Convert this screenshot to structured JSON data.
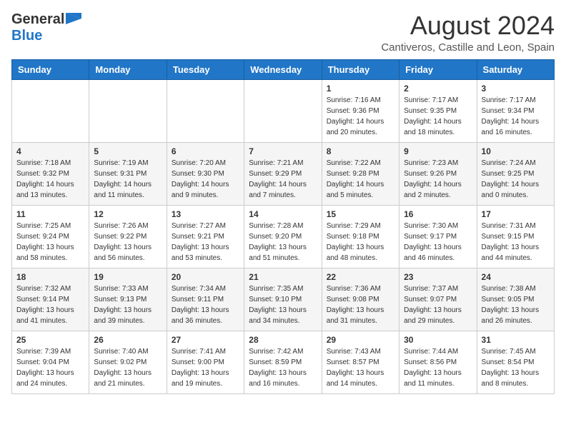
{
  "header": {
    "logo_general": "General",
    "logo_blue": "Blue",
    "month_year": "August 2024",
    "location": "Cantiveros, Castille and Leon, Spain"
  },
  "columns": [
    "Sunday",
    "Monday",
    "Tuesday",
    "Wednesday",
    "Thursday",
    "Friday",
    "Saturday"
  ],
  "weeks": [
    [
      {
        "day": "",
        "info": ""
      },
      {
        "day": "",
        "info": ""
      },
      {
        "day": "",
        "info": ""
      },
      {
        "day": "",
        "info": ""
      },
      {
        "day": "1",
        "info": "Sunrise: 7:16 AM\nSunset: 9:36 PM\nDaylight: 14 hours\nand 20 minutes."
      },
      {
        "day": "2",
        "info": "Sunrise: 7:17 AM\nSunset: 9:35 PM\nDaylight: 14 hours\nand 18 minutes."
      },
      {
        "day": "3",
        "info": "Sunrise: 7:17 AM\nSunset: 9:34 PM\nDaylight: 14 hours\nand 16 minutes."
      }
    ],
    [
      {
        "day": "4",
        "info": "Sunrise: 7:18 AM\nSunset: 9:32 PM\nDaylight: 14 hours\nand 13 minutes."
      },
      {
        "day": "5",
        "info": "Sunrise: 7:19 AM\nSunset: 9:31 PM\nDaylight: 14 hours\nand 11 minutes."
      },
      {
        "day": "6",
        "info": "Sunrise: 7:20 AM\nSunset: 9:30 PM\nDaylight: 14 hours\nand 9 minutes."
      },
      {
        "day": "7",
        "info": "Sunrise: 7:21 AM\nSunset: 9:29 PM\nDaylight: 14 hours\nand 7 minutes."
      },
      {
        "day": "8",
        "info": "Sunrise: 7:22 AM\nSunset: 9:28 PM\nDaylight: 14 hours\nand 5 minutes."
      },
      {
        "day": "9",
        "info": "Sunrise: 7:23 AM\nSunset: 9:26 PM\nDaylight: 14 hours\nand 2 minutes."
      },
      {
        "day": "10",
        "info": "Sunrise: 7:24 AM\nSunset: 9:25 PM\nDaylight: 14 hours\nand 0 minutes."
      }
    ],
    [
      {
        "day": "11",
        "info": "Sunrise: 7:25 AM\nSunset: 9:24 PM\nDaylight: 13 hours\nand 58 minutes."
      },
      {
        "day": "12",
        "info": "Sunrise: 7:26 AM\nSunset: 9:22 PM\nDaylight: 13 hours\nand 56 minutes."
      },
      {
        "day": "13",
        "info": "Sunrise: 7:27 AM\nSunset: 9:21 PM\nDaylight: 13 hours\nand 53 minutes."
      },
      {
        "day": "14",
        "info": "Sunrise: 7:28 AM\nSunset: 9:20 PM\nDaylight: 13 hours\nand 51 minutes."
      },
      {
        "day": "15",
        "info": "Sunrise: 7:29 AM\nSunset: 9:18 PM\nDaylight: 13 hours\nand 48 minutes."
      },
      {
        "day": "16",
        "info": "Sunrise: 7:30 AM\nSunset: 9:17 PM\nDaylight: 13 hours\nand 46 minutes."
      },
      {
        "day": "17",
        "info": "Sunrise: 7:31 AM\nSunset: 9:15 PM\nDaylight: 13 hours\nand 44 minutes."
      }
    ],
    [
      {
        "day": "18",
        "info": "Sunrise: 7:32 AM\nSunset: 9:14 PM\nDaylight: 13 hours\nand 41 minutes."
      },
      {
        "day": "19",
        "info": "Sunrise: 7:33 AM\nSunset: 9:13 PM\nDaylight: 13 hours\nand 39 minutes."
      },
      {
        "day": "20",
        "info": "Sunrise: 7:34 AM\nSunset: 9:11 PM\nDaylight: 13 hours\nand 36 minutes."
      },
      {
        "day": "21",
        "info": "Sunrise: 7:35 AM\nSunset: 9:10 PM\nDaylight: 13 hours\nand 34 minutes."
      },
      {
        "day": "22",
        "info": "Sunrise: 7:36 AM\nSunset: 9:08 PM\nDaylight: 13 hours\nand 31 minutes."
      },
      {
        "day": "23",
        "info": "Sunrise: 7:37 AM\nSunset: 9:07 PM\nDaylight: 13 hours\nand 29 minutes."
      },
      {
        "day": "24",
        "info": "Sunrise: 7:38 AM\nSunset: 9:05 PM\nDaylight: 13 hours\nand 26 minutes."
      }
    ],
    [
      {
        "day": "25",
        "info": "Sunrise: 7:39 AM\nSunset: 9:04 PM\nDaylight: 13 hours\nand 24 minutes."
      },
      {
        "day": "26",
        "info": "Sunrise: 7:40 AM\nSunset: 9:02 PM\nDaylight: 13 hours\nand 21 minutes."
      },
      {
        "day": "27",
        "info": "Sunrise: 7:41 AM\nSunset: 9:00 PM\nDaylight: 13 hours\nand 19 minutes."
      },
      {
        "day": "28",
        "info": "Sunrise: 7:42 AM\nSunset: 8:59 PM\nDaylight: 13 hours\nand 16 minutes."
      },
      {
        "day": "29",
        "info": "Sunrise: 7:43 AM\nSunset: 8:57 PM\nDaylight: 13 hours\nand 14 minutes."
      },
      {
        "day": "30",
        "info": "Sunrise: 7:44 AM\nSunset: 8:56 PM\nDaylight: 13 hours\nand 11 minutes."
      },
      {
        "day": "31",
        "info": "Sunrise: 7:45 AM\nSunset: 8:54 PM\nDaylight: 13 hours\nand 8 minutes."
      }
    ]
  ]
}
